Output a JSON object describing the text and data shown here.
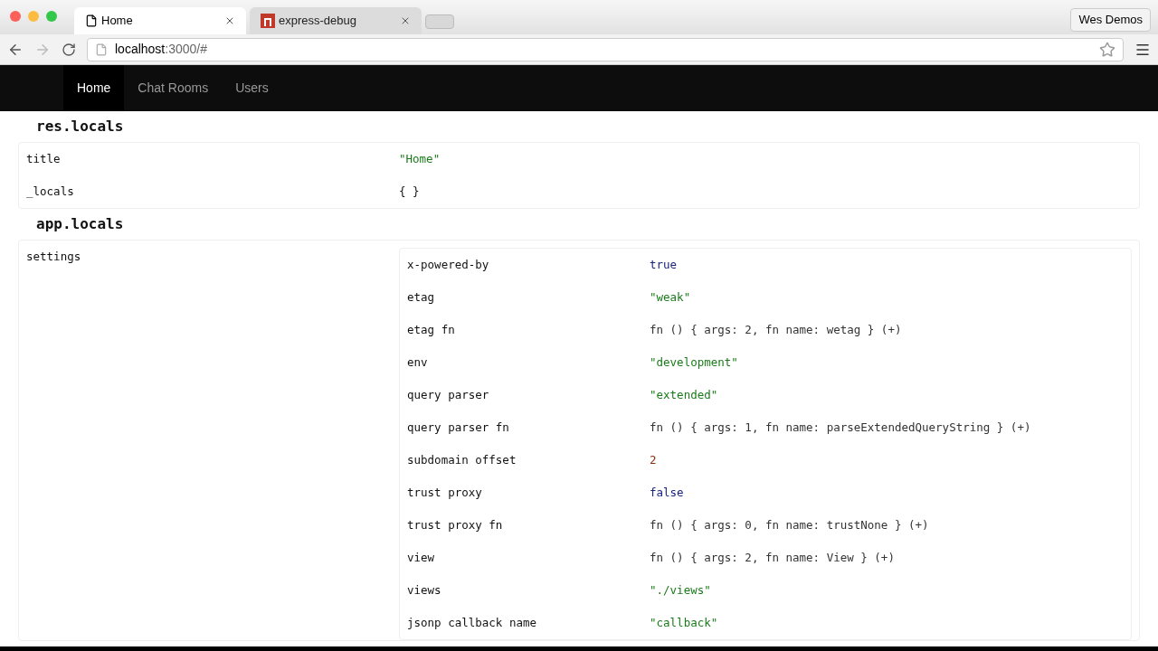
{
  "browser": {
    "tabs": [
      {
        "title": "Home",
        "selected": true,
        "kind": "page"
      },
      {
        "title": "express-debug",
        "selected": false,
        "kind": "app"
      }
    ],
    "profile": "Wes Demos",
    "url_host": "localhost",
    "url_rest": ":3000/#"
  },
  "navbar": {
    "items": [
      {
        "label": "Home",
        "selected": true
      },
      {
        "label": "Chat Rooms",
        "selected": false
      },
      {
        "label": "Users",
        "selected": false
      }
    ]
  },
  "sections": [
    {
      "heading": "res.locals",
      "rows": [
        {
          "key": "title",
          "kind": "string",
          "value": "\"Home\""
        },
        {
          "key": "_locals",
          "kind": "object",
          "value": "{ }"
        }
      ]
    },
    {
      "heading": "app.locals",
      "rows": [
        {
          "key": "settings",
          "kind": "table",
          "rows": [
            {
              "key": "x-powered-by",
              "kind": "boolean",
              "value": "true"
            },
            {
              "key": "etag",
              "kind": "string",
              "value": "\"weak\""
            },
            {
              "key": "etag fn",
              "kind": "function",
              "value": "fn () { args: 2, fn name: wetag } (+)"
            },
            {
              "key": "env",
              "kind": "string",
              "value": "\"development\""
            },
            {
              "key": "query parser",
              "kind": "string",
              "value": "\"extended\""
            },
            {
              "key": "query parser fn",
              "kind": "function",
              "value": "fn () { args: 1, fn name: parseExtendedQueryString } (+)"
            },
            {
              "key": "subdomain offset",
              "kind": "number",
              "value": "2"
            },
            {
              "key": "trust proxy",
              "kind": "boolean",
              "value": "false"
            },
            {
              "key": "trust proxy fn",
              "kind": "function",
              "value": "fn () { args: 0, fn name: trustNone } (+)"
            },
            {
              "key": "view",
              "kind": "function",
              "value": "fn () { args: 2, fn name: View } (+)"
            },
            {
              "key": "views",
              "kind": "string",
              "value": "\"./views\""
            },
            {
              "key": "jsonp callback name",
              "kind": "string",
              "value": "\"callback\""
            }
          ]
        }
      ]
    }
  ]
}
